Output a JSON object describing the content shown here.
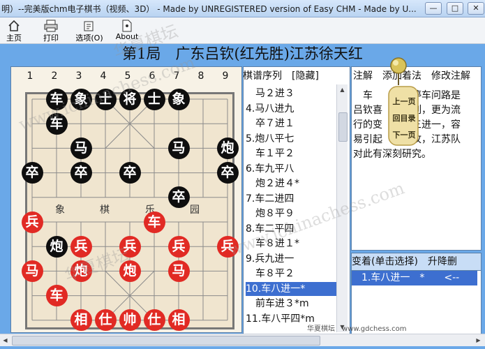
{
  "window": {
    "title": "明）--完美版chm电子棋书（视频、3D） - Made by UNREGISTERED version of Easy CHM - Made by U...",
    "min_label": "—",
    "max_label": "□",
    "close_label": "✕"
  },
  "toolbar": {
    "home_label": "主页",
    "print_label": "打印",
    "options_label": "选项(O)",
    "about_label": "About"
  },
  "game": {
    "title": "第1局　广东吕钦(红先胜)江苏徐天红",
    "columns": [
      "1",
      "2",
      "3",
      "4",
      "5",
      "6",
      "7",
      "8",
      "9"
    ],
    "river_left": [
      "象",
      "棋"
    ],
    "river_right": [
      "乐",
      "园"
    ]
  },
  "pieces": [
    {
      "label": "车",
      "color": "b",
      "col": 1,
      "row": 0
    },
    {
      "label": "象",
      "color": "b",
      "col": 2,
      "row": 0
    },
    {
      "label": "士",
      "color": "b",
      "col": 3,
      "row": 0
    },
    {
      "label": "将",
      "color": "b",
      "col": 4,
      "row": 0
    },
    {
      "label": "士",
      "color": "b",
      "col": 5,
      "row": 0
    },
    {
      "label": "象",
      "color": "b",
      "col": 6,
      "row": 0
    },
    {
      "label": "车",
      "color": "b",
      "col": 1,
      "row": 1
    },
    {
      "label": "马",
      "color": "b",
      "col": 2,
      "row": 2
    },
    {
      "label": "马",
      "color": "b",
      "col": 6,
      "row": 2
    },
    {
      "label": "炮",
      "color": "b",
      "col": 8,
      "row": 2
    },
    {
      "label": "卒",
      "color": "b",
      "col": 0,
      "row": 3
    },
    {
      "label": "卒",
      "color": "b",
      "col": 2,
      "row": 3
    },
    {
      "label": "卒",
      "color": "b",
      "col": 4,
      "row": 3
    },
    {
      "label": "卒",
      "color": "b",
      "col": 8,
      "row": 3
    },
    {
      "label": "卒",
      "color": "b",
      "col": 6,
      "row": 4
    },
    {
      "label": "兵",
      "color": "r",
      "col": 0,
      "row": 5
    },
    {
      "label": "车",
      "color": "r",
      "col": 5,
      "row": 5
    },
    {
      "label": "炮",
      "color": "b",
      "col": 1,
      "row": 6
    },
    {
      "label": "兵",
      "color": "r",
      "col": 2,
      "row": 6
    },
    {
      "label": "兵",
      "color": "r",
      "col": 4,
      "row": 6
    },
    {
      "label": "兵",
      "color": "r",
      "col": 6,
      "row": 6
    },
    {
      "label": "兵",
      "color": "r",
      "col": 8,
      "row": 6
    },
    {
      "label": "马",
      "color": "r",
      "col": 0,
      "row": 7
    },
    {
      "label": "炮",
      "color": "r",
      "col": 2,
      "row": 7
    },
    {
      "label": "炮",
      "color": "r",
      "col": 4,
      "row": 7
    },
    {
      "label": "马",
      "color": "r",
      "col": 6,
      "row": 7
    },
    {
      "label": "车",
      "color": "r",
      "col": 1,
      "row": 8
    },
    {
      "label": "相",
      "color": "r",
      "col": 2,
      "row": 9
    },
    {
      "label": "仕",
      "color": "r",
      "col": 3,
      "row": 9
    },
    {
      "label": "帅",
      "color": "r",
      "col": 4,
      "row": 9
    },
    {
      "label": "仕",
      "color": "r",
      "col": 5,
      "row": 9
    },
    {
      "label": "相",
      "color": "r",
      "col": 6,
      "row": 9
    }
  ],
  "moves_panel": {
    "header": "棋谱序列　[隐藏]",
    "moves": [
      "　马２进３",
      " 4.马八进九",
      "　卒７进１",
      " 5.炮八平七",
      "　车１平２",
      " 6.车九平八",
      "　炮２进４*",
      " 7.车二进四",
      "　炮８平９",
      " 8.车二平四",
      "　车８进１*",
      " 9.兵九进一",
      "　车８平２",
      "10.车八进一*",
      "　前车进３*m",
      "11.车八平四*m"
    ],
    "selected_index": 13
  },
  "comment_panel": {
    "header": "注解　添加着法　修改注解",
    "lines": [
      "　车　　　　停车问路是",
      "吕钦喜　　　列，更为流",
      "行的变　　　三进一，容",
      "易引起　　　攻，江苏队",
      "对此有深刻研究。"
    ]
  },
  "variations": {
    "header": "变着(单击选择)　升降删",
    "items": [
      "　1.车八进一　*　　<--"
    ]
  },
  "widget": {
    "lines": [
      "上一页",
      "回目录",
      "下一页"
    ]
  },
  "footer": {
    "site": "华夏棋坛　www.gdchess.com"
  },
  "watermarks": [
    "www.ichinachess.com",
    "华夏棋坛"
  ]
}
